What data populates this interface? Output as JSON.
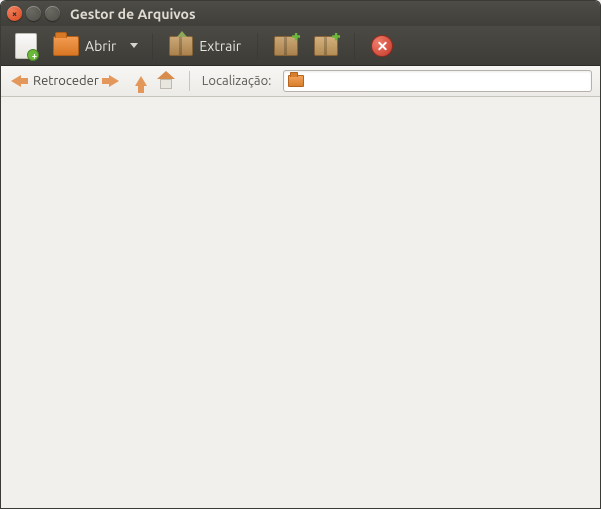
{
  "window": {
    "title": "Gestor de Arquivos"
  },
  "toolbar": {
    "open_label": "Abrir",
    "extract_label": "Extrair"
  },
  "navbar": {
    "back_label": "Retroceder",
    "location_label": "Localização:",
    "location_value": ""
  }
}
